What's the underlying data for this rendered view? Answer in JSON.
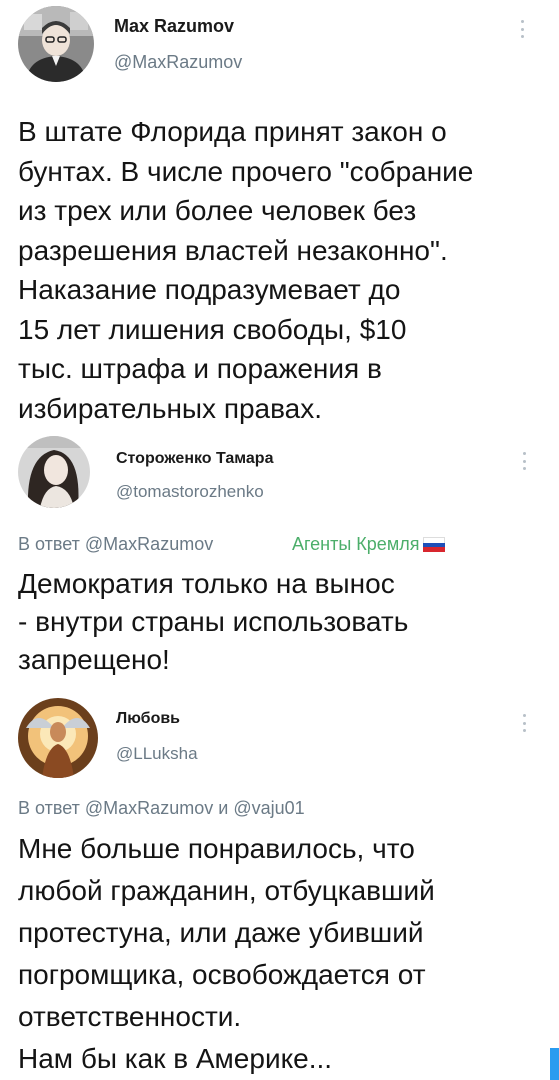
{
  "tweet1": {
    "name": "Max Razumov",
    "handle": "@MaxRazumov",
    "lines": [
      "В штате Флорида принят закон о",
      "бунтах. В числе прочего \"собрание",
      "из трех или более человек без",
      "разрешения властей незаконно\".",
      "Наказание подразумевает до",
      "15 лет лишения свободы, $10",
      "тыс. штрафа и поражения в",
      "избирательных правах."
    ]
  },
  "tweet2": {
    "name": "Стороженко Тамара",
    "handle": "@tomastorozhenko",
    "reply_prefix": "В ответ",
    "reply_to": "@MaxRazumov",
    "agent_label": "Агенты Кремля",
    "flag_colors": [
      "#ffffff",
      "#1f4fb8",
      "#d8262e"
    ],
    "lines": [
      "Демократия только на вынос",
      "- внутри страны использовать",
      "запрещено!"
    ]
  },
  "tweet3": {
    "name": "Любовь",
    "handle": "@LLuksha",
    "reply_prefix": "В ответ",
    "reply_to": "@MaxRazumov",
    "reply_and": "и",
    "reply_to2": "@vaju01",
    "lines": [
      "Мне больше понравилось, что",
      "любой гражданин, отбуцкавший",
      "протестуна, или даже убивший",
      "погромщика, освобождается от",
      "ответственности.",
      "Нам бы как в Америке..."
    ]
  },
  "colors": {
    "handle_gray": "#6b7a86",
    "agent_green": "#4cae6a",
    "scroll_accent": "#2a9cf0"
  }
}
